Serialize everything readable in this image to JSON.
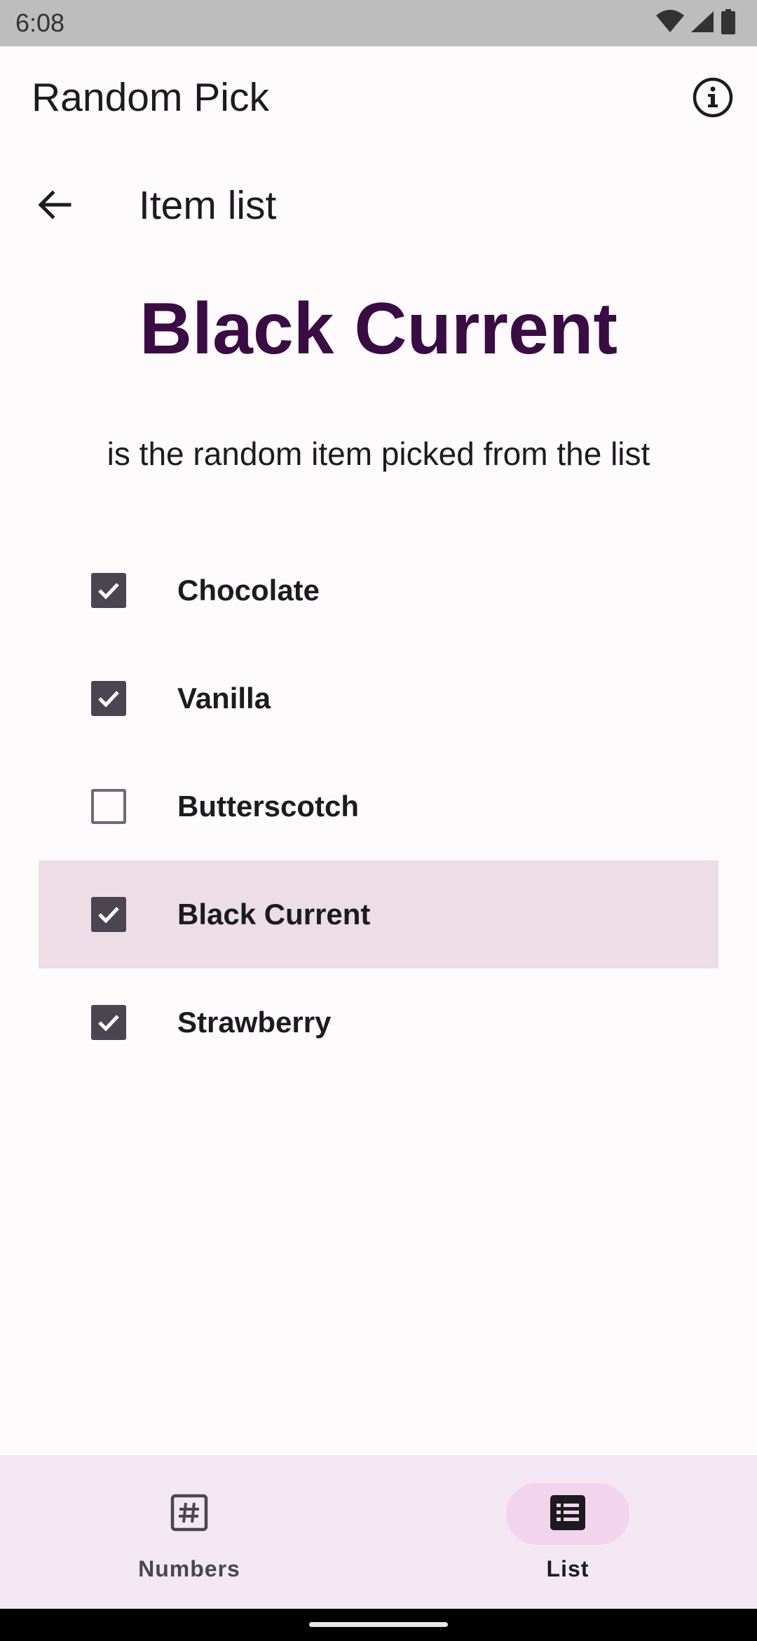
{
  "status_bar": {
    "time": "6:08",
    "icons": [
      "wifi-icon",
      "cellular-signal-icon",
      "battery-icon"
    ]
  },
  "app_bar": {
    "title": "Random Pick",
    "info_icon": "info-icon"
  },
  "sub_header": {
    "back_icon": "arrow-back-icon",
    "title": "Item list"
  },
  "result": {
    "value": "Black Current",
    "caption": "is the random item picked from the list"
  },
  "items": [
    {
      "label": "Chocolate",
      "checked": true,
      "highlighted": false
    },
    {
      "label": "Vanilla",
      "checked": true,
      "highlighted": false
    },
    {
      "label": "Butterscotch",
      "checked": false,
      "highlighted": false
    },
    {
      "label": "Black Current",
      "checked": true,
      "highlighted": true
    },
    {
      "label": "Strawberry",
      "checked": true,
      "highlighted": false
    }
  ],
  "bottom_nav": {
    "items": [
      {
        "label": "Numbers",
        "icon": "hash-icon",
        "selected": false
      },
      {
        "label": "List",
        "icon": "list-icon",
        "selected": true
      }
    ]
  },
  "colors": {
    "accent": "#3a0b45",
    "highlight_row": "#ecdde6",
    "nav_background": "#f4e7f4",
    "nav_active_indicator": "#f2d5ec",
    "checkbox_fill": "#4a4550"
  }
}
